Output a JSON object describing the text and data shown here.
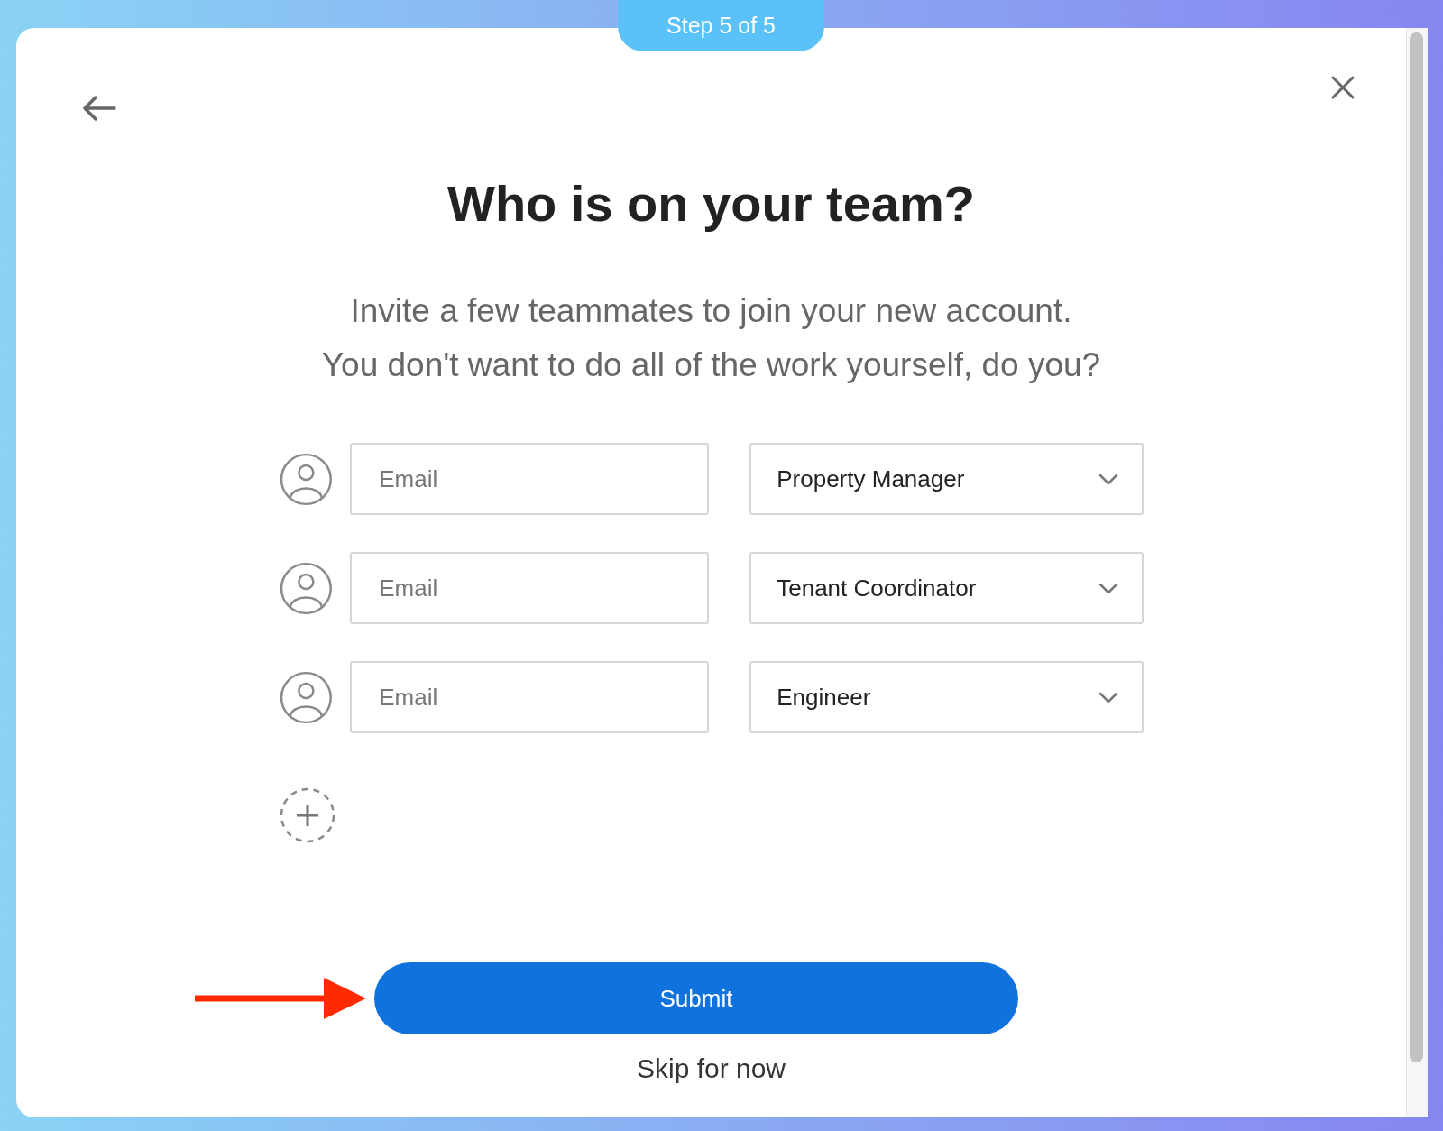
{
  "step_badge": "Step 5 of 5",
  "title": "Who is on your team?",
  "subtitle_lines": [
    "Invite a few teammates to join your new account.",
    "You don't want to do all of the work yourself, do you?"
  ],
  "invites": [
    {
      "email": {
        "placeholder": "Email"
      },
      "role": "Property Manager"
    },
    {
      "email": {
        "placeholder": "Email"
      },
      "role": "Tenant Coordinator"
    },
    {
      "email": {
        "placeholder": "Email"
      },
      "role": "Engineer"
    }
  ],
  "submit_button": "Submit",
  "skip_link": "Skip for now"
}
